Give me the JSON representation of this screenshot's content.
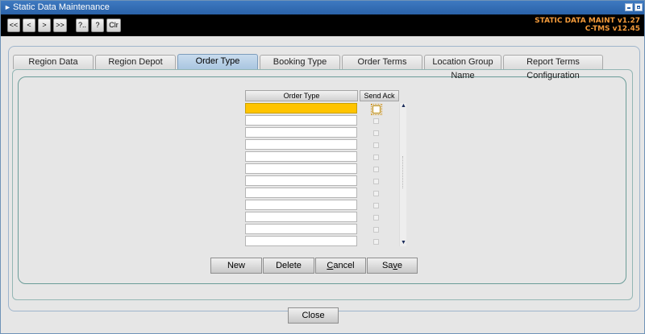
{
  "window": {
    "title": "Static Data Maintenance",
    "icon": "app-arrow-icon"
  },
  "toolbar": {
    "buttons": [
      "<<",
      "<",
      ">",
      ">>",
      "?..",
      "?",
      "Clr"
    ],
    "version_line1": "STATIC DATA MAINT v1.27",
    "version_line2": "C-TMS v12.45",
    "version_color": "#f39a3a"
  },
  "tabs": [
    {
      "label": "Region Data",
      "active": false
    },
    {
      "label": "Region Depot",
      "active": false
    },
    {
      "label": "Order Type",
      "active": true
    },
    {
      "label": "Booking Type",
      "active": false
    },
    {
      "label": "Order Terms",
      "active": false
    },
    {
      "label": "Location Group Name",
      "active": false
    },
    {
      "label": "Report Terms Configuration",
      "active": false
    }
  ],
  "grid": {
    "columns": [
      "Order Type",
      "Send Ack"
    ],
    "rows": [
      {
        "order_type": "",
        "send_ack": false,
        "selected": true
      },
      {
        "order_type": "",
        "send_ack": false,
        "selected": false
      },
      {
        "order_type": "",
        "send_ack": false,
        "selected": false
      },
      {
        "order_type": "",
        "send_ack": false,
        "selected": false
      },
      {
        "order_type": "",
        "send_ack": false,
        "selected": false
      },
      {
        "order_type": "",
        "send_ack": false,
        "selected": false
      },
      {
        "order_type": "",
        "send_ack": false,
        "selected": false
      },
      {
        "order_type": "",
        "send_ack": false,
        "selected": false
      },
      {
        "order_type": "",
        "send_ack": false,
        "selected": false
      },
      {
        "order_type": "",
        "send_ack": false,
        "selected": false
      },
      {
        "order_type": "",
        "send_ack": false,
        "selected": false
      },
      {
        "order_type": "",
        "send_ack": false,
        "selected": false
      }
    ],
    "selected_color": "#ffc400"
  },
  "actions": {
    "new_label": "New",
    "delete_label": "Delete",
    "cancel_prefix": "",
    "cancel_mnemonic": "C",
    "cancel_rest": "ancel",
    "save_prefix": "Sa",
    "save_mnemonic": "v",
    "save_rest": "e"
  },
  "footer": {
    "close_label": "Close"
  },
  "colors": {
    "titlebar": "#2a62a8",
    "active_tab": "#a9c5e0"
  }
}
